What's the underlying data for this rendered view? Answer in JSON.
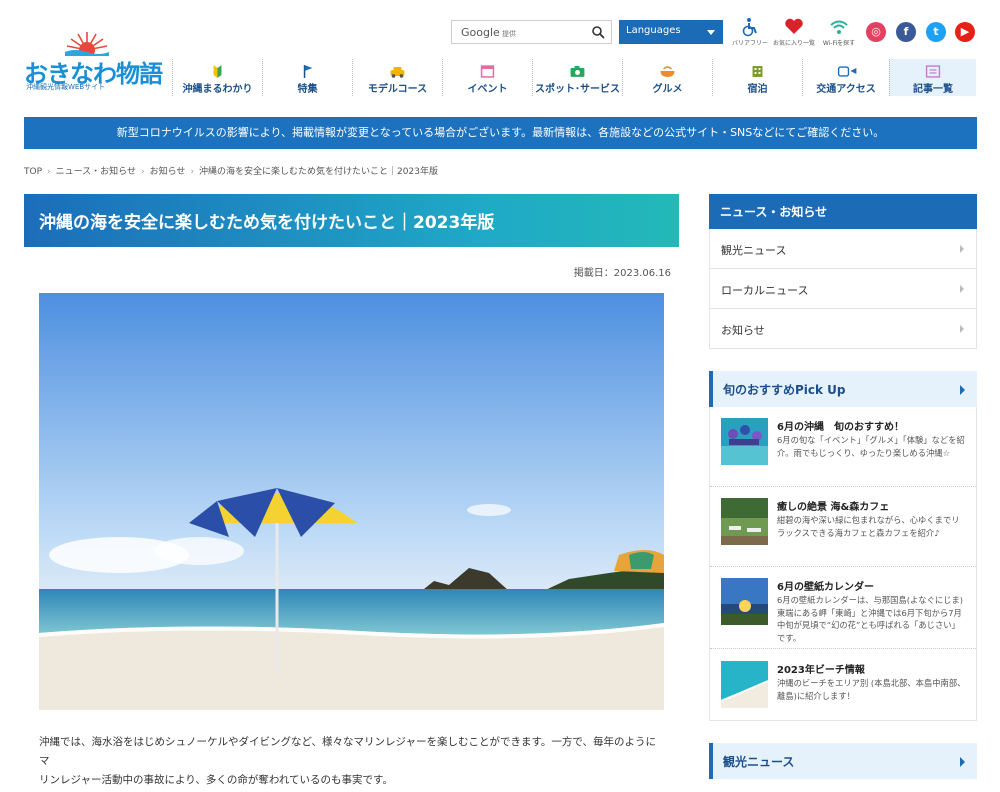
{
  "logo": {
    "title": "おきなわ物語",
    "subtitle": "沖縄観光情報WEBサイト"
  },
  "search": {
    "brand": "Google",
    "note": "提供"
  },
  "languages_label": "Languages",
  "utility_links": [
    {
      "icon": "wheelchair-icon",
      "label": "バリアフリー"
    },
    {
      "icon": "heart-icon",
      "label": "お気に入り一覧"
    },
    {
      "icon": "wifi-icon",
      "label": "Wi-Fiを探す"
    }
  ],
  "nav": [
    {
      "icon": "beginner-leaf-icon",
      "label": "沖縄まるわかり"
    },
    {
      "icon": "flag-icon",
      "label": "特集"
    },
    {
      "icon": "car-icon",
      "label": "モデルコース"
    },
    {
      "icon": "calendar-icon",
      "label": "イベント"
    },
    {
      "icon": "camera-icon",
      "label": "スポット･サービス"
    },
    {
      "icon": "food-icon",
      "label": "グルメ"
    },
    {
      "icon": "hotel-icon",
      "label": "宿泊"
    },
    {
      "icon": "transport-icon",
      "label": "交通アクセス"
    },
    {
      "icon": "article-icon",
      "label": "記事一覧"
    }
  ],
  "notice": "新型コロナウイルスの影響により、掲載情報が変更となっている場合がございます。最新情報は、各施設などの公式サイト・SNSなどにてご確認ください。",
  "breadcrumb": [
    "TOP",
    "ニュース・お知らせ",
    "お知らせ",
    "沖縄の海を安全に楽しむため気を付けたいこと｜2023年版"
  ],
  "article": {
    "title": "沖縄の海を安全に楽しむため気を付けたいこと｜2023年版",
    "date": "掲載日：2023.06.16",
    "body_line1": "沖縄では、海水浴をはじめシュノーケルやダイビングなど、様々なマリンレジャーを楽しむことができます。一方で、毎年のようにマ",
    "body_line2": "リンレジャー活動中の事故により、多くの命が奪われているのも事実です。"
  },
  "sidebar": {
    "news_head": "ニュース・お知らせ",
    "news_links": [
      "観光ニュース",
      "ローカルニュース",
      "お知らせ"
    ],
    "pickup_head": "旬のおすすめPick Up",
    "pickup": [
      {
        "title": "6月の沖縄　旬のおすすめ！",
        "desc": "6月の旬な「イベント」「グルメ」「体験」などを紹介。雨でもじっくり、ゆったり楽しめる沖縄☆"
      },
      {
        "title": "癒しの絶景 海&森カフェ",
        "desc": "紺碧の海や深い緑に包まれながら、心ゆくまでリラックスできる海カフェと森カフェを紹介♪"
      },
      {
        "title": "6月の壁紙カレンダー",
        "desc": "6月の壁紙カレンダーは、与那国島(よなぐにじま)東端にある岬「東崎」と沖縄では6月下旬から7月中旬が見頃で“幻の花”とも呼ばれる「あじさい」です。"
      },
      {
        "title": "2023年ビーチ情報",
        "desc": "沖縄のビーチをエリア別 (本島北部、本島中南部、離島)に紹介します！"
      }
    ],
    "kanko_head": "観光ニュース"
  },
  "colors": {
    "primary": "#1c6bb7",
    "notice_bg": "#1c72bf",
    "instagram": "#e4405f",
    "facebook": "#3b5998",
    "twitter": "#1da1f2",
    "youtube": "#e62117"
  }
}
